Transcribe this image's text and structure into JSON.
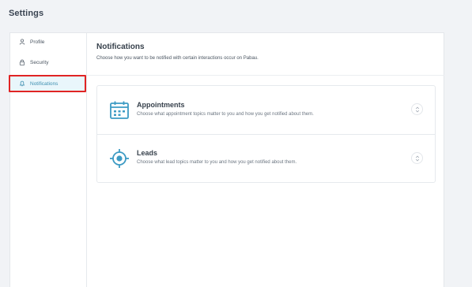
{
  "page": {
    "title": "Settings"
  },
  "sidebar": {
    "items": [
      {
        "label": "Profile",
        "icon": "user-icon"
      },
      {
        "label": "Security",
        "icon": "lock-icon"
      },
      {
        "label": "Notifications",
        "icon": "bell-icon",
        "active": true
      }
    ]
  },
  "main": {
    "title": "Notifications",
    "subtitle": "Choose how you want to be notified with certain interactions occur on Pabau.",
    "cards": [
      {
        "title": "Appointments",
        "description": "Choose what appointment topics matter to you and how you get notified about them.",
        "icon": "calendar-icon",
        "action_icon": "expand-icon"
      },
      {
        "title": "Leads",
        "description": "Choose what lead topics matter to you and how you get notified about them.",
        "icon": "target-icon",
        "action_icon": "expand-icon"
      }
    ]
  },
  "colors": {
    "accent": "#3d8fb0",
    "active_bg": "#e9f6fb",
    "highlight_border": "#e02424",
    "background": "#f1f3f6"
  }
}
